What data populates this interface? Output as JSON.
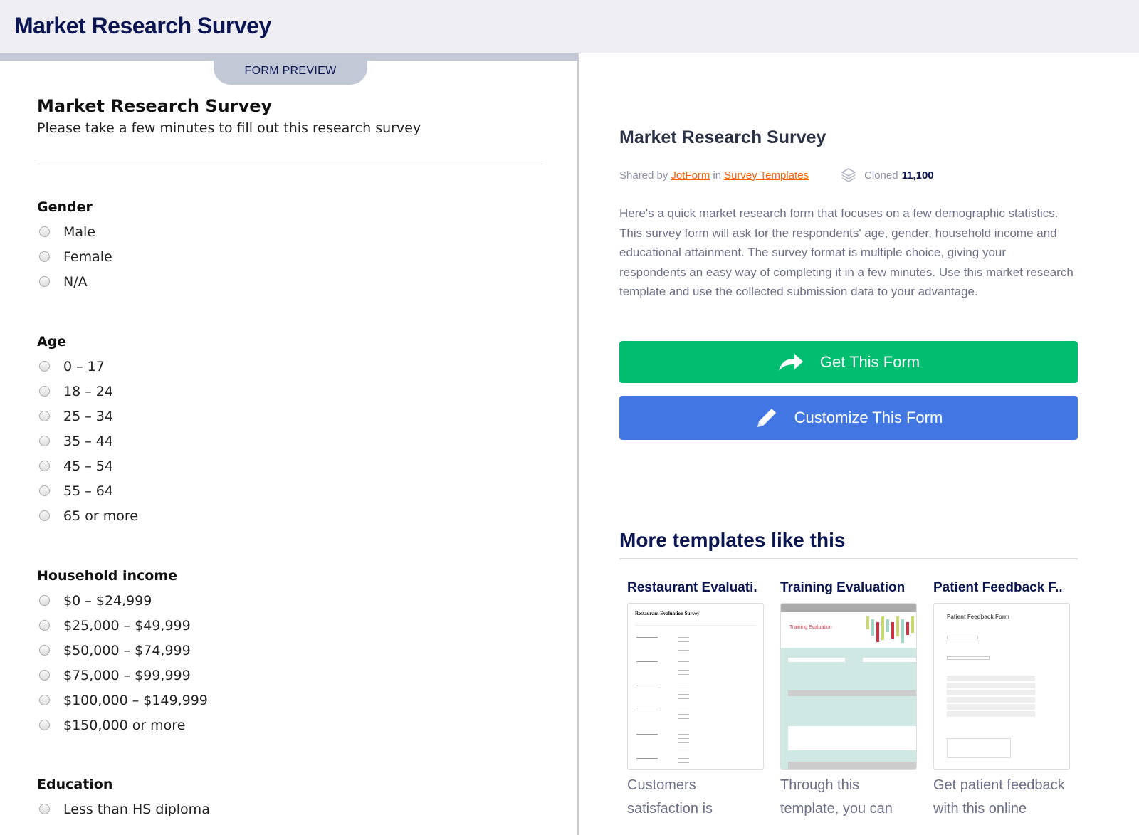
{
  "header": {
    "title": "Market Research Survey"
  },
  "preview": {
    "tab_label": "FORM PREVIEW",
    "form_title": "Market Research Survey",
    "form_subtitle": "Please take a few minutes to fill out this research survey",
    "questions": [
      {
        "label": "Gender",
        "options": [
          "Male",
          "Female",
          "N/A"
        ]
      },
      {
        "label": "Age",
        "options": [
          "0 – 17",
          "18 – 24",
          "25 – 34",
          "35 – 44",
          "45 – 54",
          "55 – 64",
          "65 or more"
        ]
      },
      {
        "label": "Household income",
        "options": [
          "$0 – $24,999",
          "$25,000 – $49,999",
          "$50,000 – $74,999",
          "$75,000 – $99,999",
          "$100,000 – $149,999",
          "$150,000 or more"
        ]
      },
      {
        "label": "Education",
        "options": [
          "Less than HS diploma"
        ]
      }
    ]
  },
  "details": {
    "title": "Market Research Survey",
    "shared_by": "Shared by",
    "author": "JotForm",
    "in": "in",
    "category": "Survey Templates",
    "cloned_label": "Cloned",
    "cloned_count": "11,100",
    "description": "Here's a quick market research form that focuses on a few demographic statistics. This survey form will ask for the respondents' age, gender, household income and educational attainment. The survey format is multiple choice, giving your respondents an easy way of completing it in a few minutes. Use this market research template and use the collected submission data to your advantage.",
    "get_button": "Get This Form",
    "customize_button": "Customize This Form",
    "get_color": "#01bd6f",
    "customize_color": "#4277e3"
  },
  "more": {
    "heading": "More templates like this",
    "cards": [
      {
        "title": "Restaurant Evaluati...",
        "thumb_title": "Restaurant Evaluation Survey",
        "desc": [
          "Customers",
          "satisfaction is"
        ]
      },
      {
        "title": "Training Evaluation",
        "thumb_title": "Training Evaluation",
        "desc": [
          "Through this",
          "template, you can"
        ]
      },
      {
        "title": "Patient Feedback F...",
        "thumb_title": "Patient Feedback Form",
        "desc": [
          "Get patient feedback",
          "with this online"
        ]
      }
    ]
  }
}
